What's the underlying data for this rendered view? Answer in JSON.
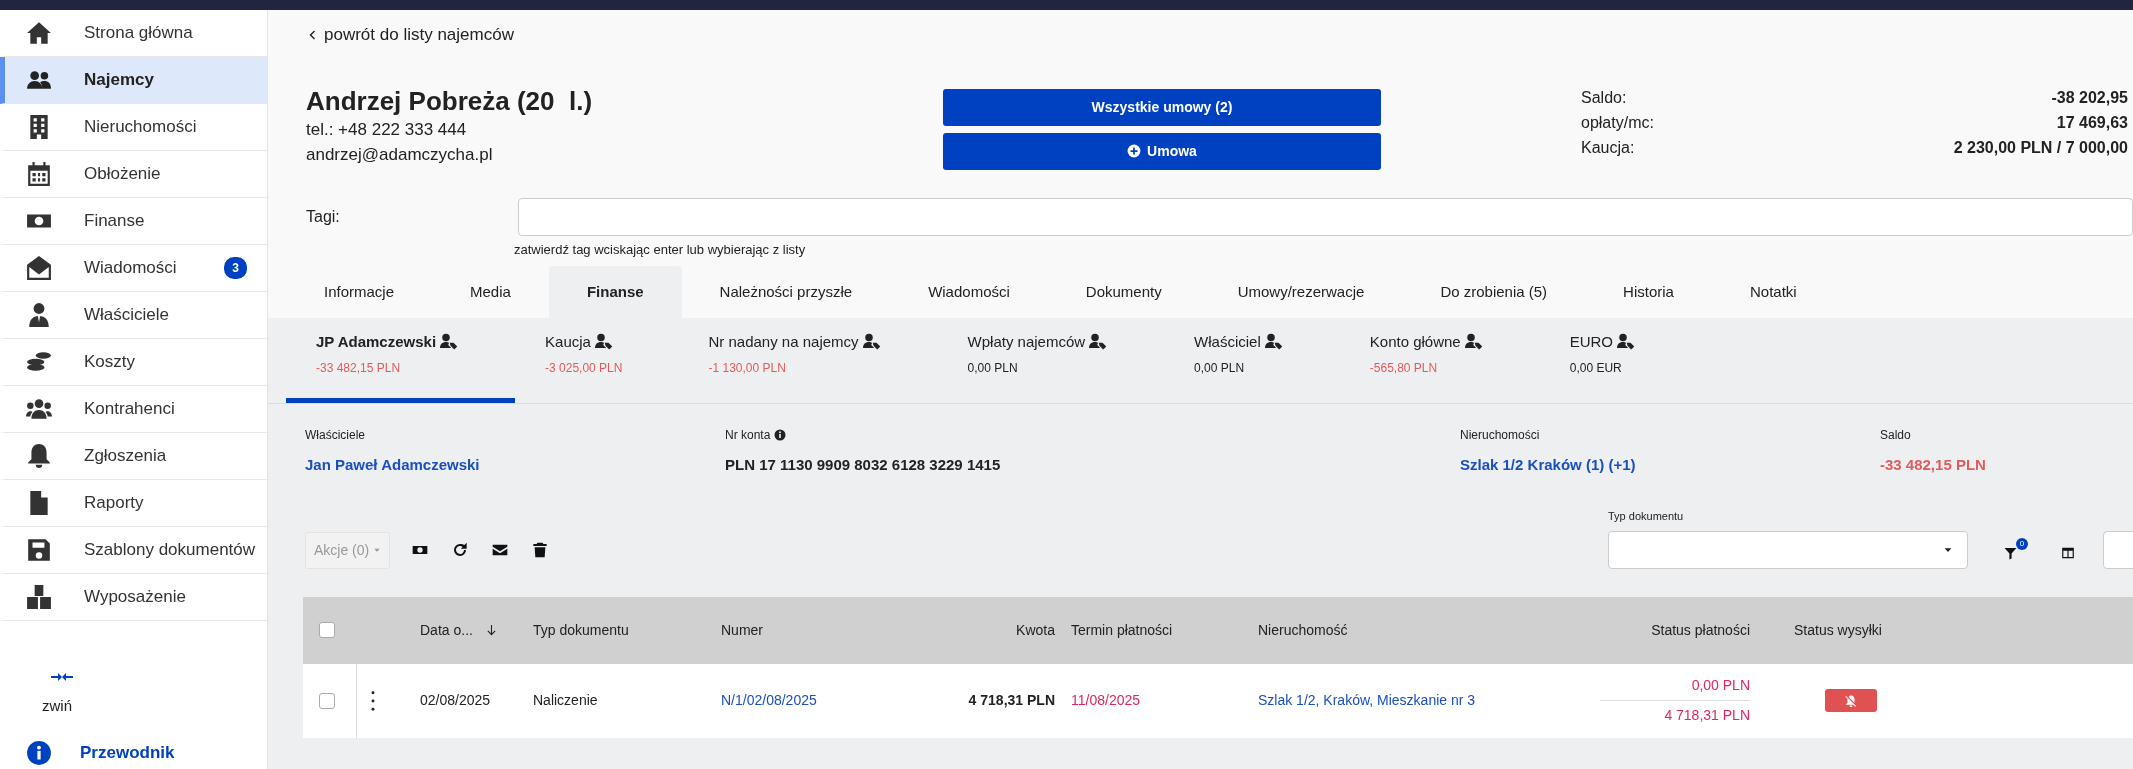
{
  "sidebar": {
    "items": [
      {
        "label": "Strona główna",
        "selected": false
      },
      {
        "label": "Najemcy",
        "selected": true
      },
      {
        "label": "Nieruchomości",
        "selected": false
      },
      {
        "label": "Obłożenie",
        "selected": false
      },
      {
        "label": "Finanse",
        "selected": false
      },
      {
        "label": "Wiadomości",
        "selected": false,
        "badge": "3"
      },
      {
        "label": "Właściciele",
        "selected": false
      },
      {
        "label": "Koszty",
        "selected": false
      },
      {
        "label": "Kontrahenci",
        "selected": false
      },
      {
        "label": "Zgłoszenia",
        "selected": false
      },
      {
        "label": "Raporty",
        "selected": false
      },
      {
        "label": "Szablony dokumentów",
        "selected": false
      },
      {
        "label": "Wyposażenie",
        "selected": false
      }
    ],
    "collapse_label": "zwiń",
    "guide_label": "Przewodnik"
  },
  "back_link": "powrót do listy najemców",
  "tenant": {
    "name": "Andrzej Pobreża (20  l.)",
    "phone": "tel.: +48 222 333 444",
    "email": "andrzej@adamczycha.pl"
  },
  "buttons": [
    {
      "label": "Wszystkie umowy (2)",
      "kind": "plain"
    },
    {
      "label": "Umowa",
      "kind": "add"
    }
  ],
  "summary": [
    {
      "label": "Saldo:",
      "value": "-38 202,95"
    },
    {
      "label": "opłaty/mc:",
      "value": "17 469,63"
    },
    {
      "label": "Kaucja:",
      "value": "2 230,00 PLN / 7 000,00"
    }
  ],
  "tags": {
    "label": "Tagi:",
    "hint": "zatwierdź tag wciskając enter lub wybierając z listy"
  },
  "tabs": [
    {
      "label": "Informacje",
      "selected": false
    },
    {
      "label": "Media",
      "selected": false
    },
    {
      "label": "Finanse",
      "selected": true
    },
    {
      "label": "Należności przyszłe",
      "selected": false
    },
    {
      "label": "Wiadomości",
      "selected": false
    },
    {
      "label": "Dokumenty",
      "selected": false
    },
    {
      "label": "Umowy/rezerwacje",
      "selected": false
    },
    {
      "label": "Do zrobienia (5)",
      "selected": false
    },
    {
      "label": "Historia",
      "selected": false
    },
    {
      "label": "Notatki",
      "selected": false
    }
  ],
  "accounts": [
    {
      "name": "JP Adamczewski",
      "amount": "-33 482,15 PLN",
      "negative": true,
      "selected": true
    },
    {
      "name": "Kaucja",
      "amount": "-3 025,00 PLN",
      "negative": true,
      "selected": false
    },
    {
      "name": "Nr nadany na najemcy",
      "amount": "-1 130,00 PLN",
      "negative": true,
      "selected": false
    },
    {
      "name": "Wpłaty najemców",
      "amount": "0,00 PLN",
      "negative": false,
      "selected": false
    },
    {
      "name": "Właściciel",
      "amount": "0,00 PLN",
      "negative": false,
      "selected": false
    },
    {
      "name": "Konto główne",
      "amount": "-565,80 PLN",
      "negative": true,
      "selected": false
    },
    {
      "name": "EURO",
      "amount": "0,00 EUR",
      "negative": false,
      "selected": false
    }
  ],
  "details": [
    {
      "label": "Właściciele",
      "value": "Jan Paweł Adamczewski",
      "kind": "link"
    },
    {
      "label": "Nr konta",
      "value": "PLN 17 1130 9909 8032 6128 3229 1415",
      "kind": "info"
    },
    {
      "label": "Nieruchomości",
      "value": "Szlak 1/2 Kraków (1) (+1)",
      "kind": "link"
    },
    {
      "label": "Saldo",
      "value": "-33 482,15 PLN",
      "kind": "negative"
    }
  ],
  "toolbar": {
    "actions_label": "Akcje (0)",
    "actions_disabled": true,
    "doc_type_label": "Typ dokumentu",
    "filter_count": "0"
  },
  "table": {
    "all_checked": false,
    "columns": [
      {
        "label": "Data o...",
        "sorted": true
      },
      {
        "label": "Typ dokumentu",
        "sorted": false
      },
      {
        "label": "Numer",
        "sorted": false
      },
      {
        "label": "Kwota",
        "sorted": false
      },
      {
        "label": "Termin płatności",
        "sorted": false
      },
      {
        "label": "Nieruchomość",
        "sorted": false
      },
      {
        "label": "Status płatności",
        "sorted": false
      },
      {
        "label": "Status wysyłki",
        "sorted": false
      }
    ],
    "rows": [
      {
        "checked": false,
        "date": "02/08/2025",
        "type": "Naliczenie",
        "number": "N/1/02/08/2025",
        "amount": "4 718,31 PLN",
        "due": "11/08/2025",
        "property": "Szlak 1/2, Kraków, Mieszkanie nr 3",
        "paid": "0,00 PLN",
        "remaining": "4 718,31 PLN"
      }
    ]
  }
}
